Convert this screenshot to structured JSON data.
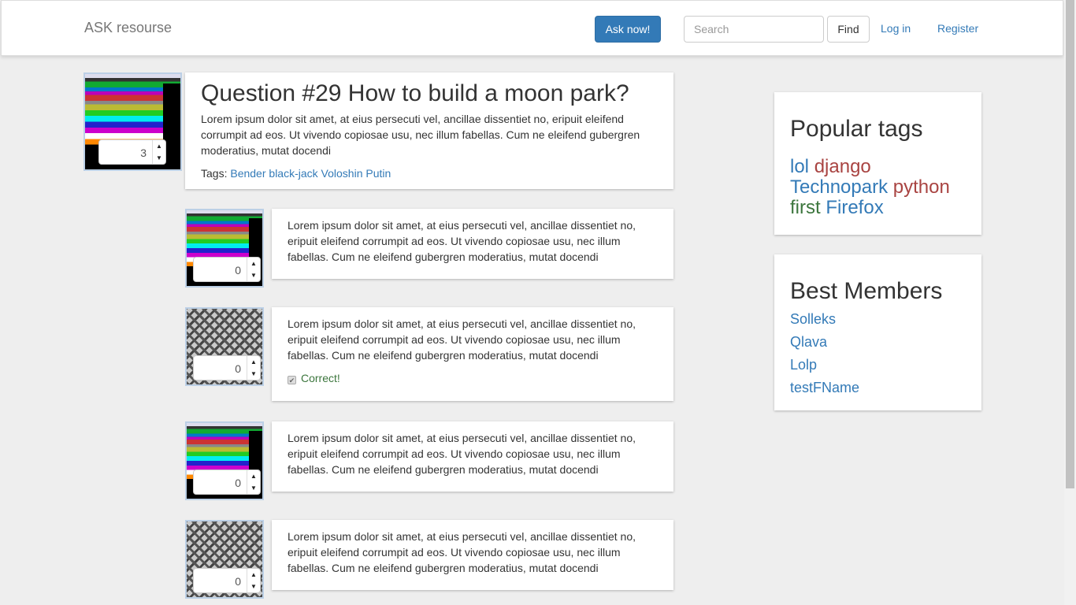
{
  "navbar": {
    "brand": "ASK resourse",
    "ask_label": "Ask now!",
    "search_placeholder": "Search",
    "find_label": "Find",
    "login_label": "Log in",
    "register_label": "Register"
  },
  "question": {
    "title": "Question #29 How to build a moon park?",
    "body": "Lorem ipsum dolor sit amet, at eius persecuti vel, ancillae dissentiet no, eripuit eleifend corrumpit ad eos. Ut vivendo copiosae usu, nec illum fabellas. Cum ne eleifend gubergren moderatius, mutat docendi",
    "tags_label": "Tags:",
    "tags": [
      "Bender",
      "black-jack",
      "Voloshin",
      "Putin"
    ],
    "votes": "3",
    "avatar_icon": "color-grid-avatar"
  },
  "answers": [
    {
      "text": "Lorem ipsum dolor sit amet, at eius persecuti vel, ancillae dissentiet no, eripuit eleifend corrumpit ad eos. Ut vivendo copiosae usu, nec illum fabellas. Cum ne eleifend gubergren moderatius, mutat docendi",
      "votes": "0",
      "avatar_icon": "color-grid-avatar"
    },
    {
      "text": "Lorem ipsum dolor sit amet, at eius persecuti vel, ancillae dissentiet no, eripuit eleifend corrumpit ad eos. Ut vivendo copiosae usu, nec illum fabellas. Cum ne eleifend gubergren moderatius, mutat docendi",
      "votes": "0",
      "avatar_icon": "checker-avatar",
      "correct_label": "Correct!",
      "correct": true
    },
    {
      "text": "Lorem ipsum dolor sit amet, at eius persecuti vel, ancillae dissentiet no, eripuit eleifend corrumpit ad eos. Ut vivendo copiosae usu, nec illum fabellas. Cum ne eleifend gubergren moderatius, mutat docendi",
      "votes": "0",
      "avatar_icon": "color-grid-avatar"
    },
    {
      "text": "Lorem ipsum dolor sit amet, at eius persecuti vel, ancillae dissentiet no, eripuit eleifend corrumpit ad eos. Ut vivendo copiosae usu, nec illum fabellas. Cum ne eleifend gubergren moderatius, mutat docendi",
      "votes": "0",
      "avatar_icon": "checker-avatar"
    }
  ],
  "sidebar": {
    "tags_title": "Popular tags",
    "tags": [
      {
        "label": "lol",
        "color": "#337ab7"
      },
      {
        "label": "django",
        "color": "#a94442"
      },
      {
        "label": "Technopark",
        "color": "#337ab7"
      },
      {
        "label": "python",
        "color": "#a94442"
      },
      {
        "label": "first",
        "color": "#3c763d"
      },
      {
        "label": "Firefox",
        "color": "#337ab7"
      }
    ],
    "members_title": "Best Members",
    "members": [
      "Solleks",
      "Qlava",
      "Lolp",
      "testFName"
    ]
  },
  "icons": {
    "spin_up": "▲",
    "spin_down": "▼",
    "check": "✔"
  }
}
